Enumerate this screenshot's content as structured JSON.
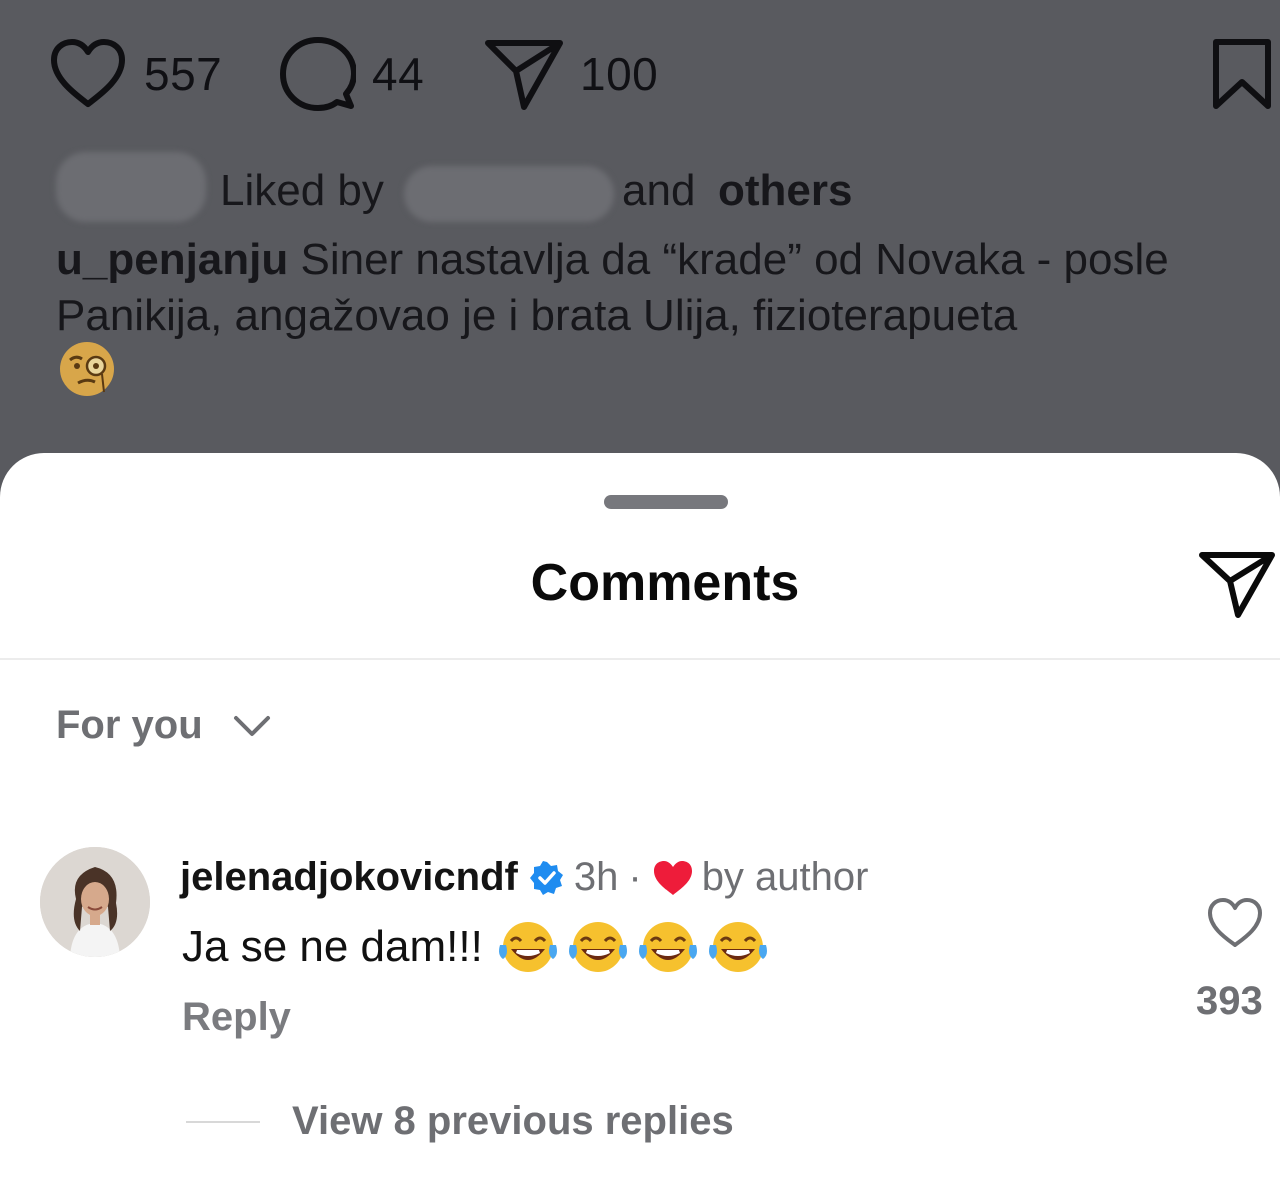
{
  "post": {
    "likes": "557",
    "comments": "44",
    "shares": "100",
    "liked_by_label": "Liked by",
    "and_label": "and",
    "others_label": "others",
    "caption_user": "u_penjanju",
    "caption_text": "Siner nastavlja da “krade” od Novaka - posle Panikija, angažovao je i brata Ulija, fizioterapueta",
    "caption_emoji": "face-with-monocle-emoji"
  },
  "sheet": {
    "title": "Comments",
    "sort_label": "For you"
  },
  "comment": {
    "username": "jelenadjokovicndf",
    "verified": true,
    "time": "3h",
    "separator": "·",
    "author_like_label": "by author",
    "text": "Ja se ne dam!!!",
    "emoji": "face-with-tears-of-joy-emoji",
    "emoji_count": 4,
    "reply_label": "Reply",
    "like_count": "393",
    "view_replies_label": "View 8 previous replies"
  },
  "colors": {
    "overlay": "#595a5f",
    "verified_blue": "#1f8cf0",
    "heart_red": "#ee1c3a",
    "muted_text": "#6e6f73"
  }
}
